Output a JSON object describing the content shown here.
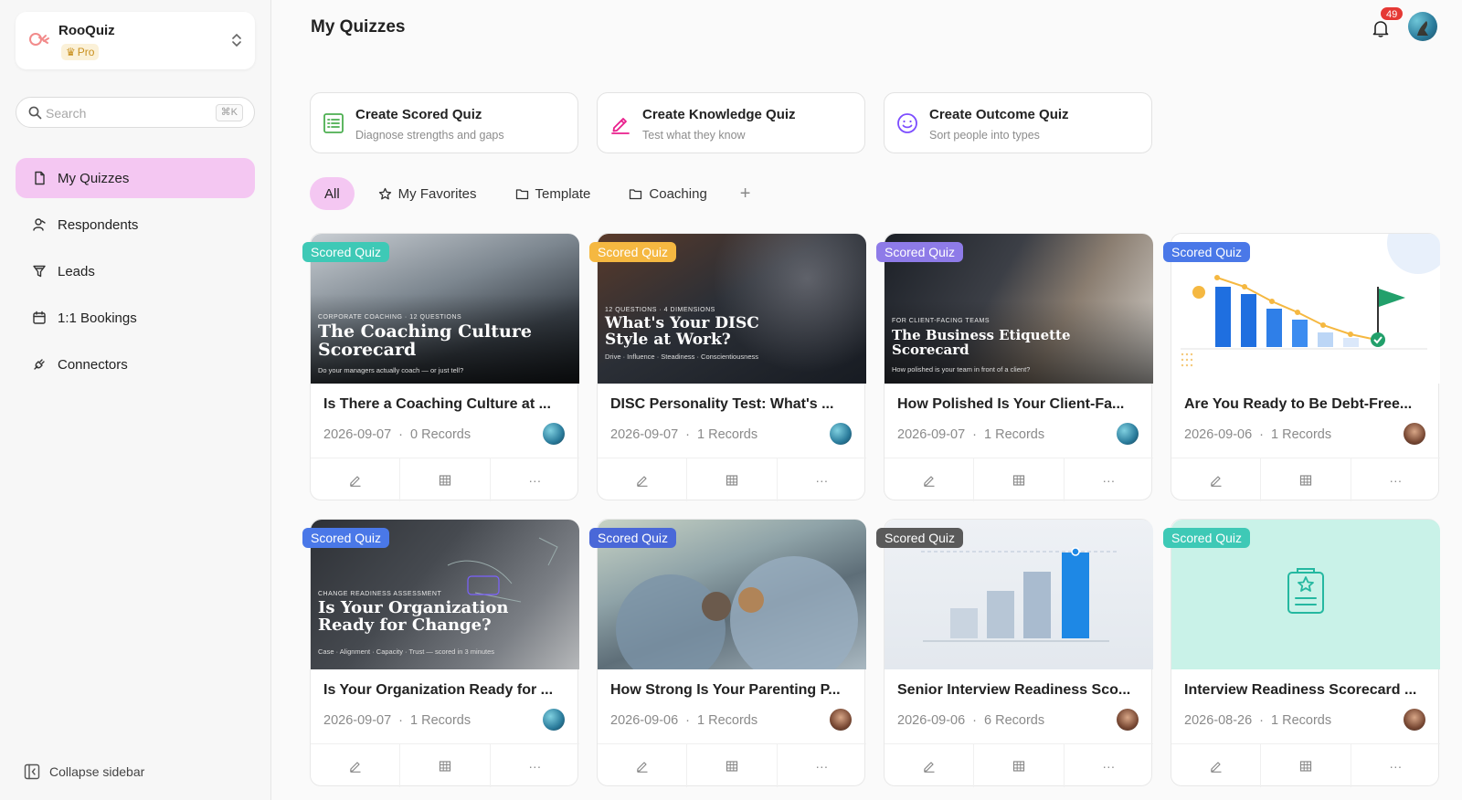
{
  "workspace": {
    "name": "RooQuiz",
    "plan": "Pro"
  },
  "search": {
    "placeholder": "Search",
    "shortcut": "⌘K"
  },
  "nav": [
    {
      "label": "My Quizzes",
      "icon": "document-icon",
      "active": true
    },
    {
      "label": "Respondents",
      "icon": "users-icon"
    },
    {
      "label": "Leads",
      "icon": "funnel-icon"
    },
    {
      "label": "1:1 Bookings",
      "icon": "calendar-icon"
    },
    {
      "label": "Connectors",
      "icon": "plug-icon"
    }
  ],
  "collapse_label": "Collapse sidebar",
  "page_title": "My Quizzes",
  "notifications": {
    "count": "49"
  },
  "create_cards": [
    {
      "title": "Create Scored Quiz",
      "subtitle": "Diagnose strengths and gaps",
      "icon": "checklist-icon",
      "color": "#4caf50"
    },
    {
      "title": "Create Knowledge Quiz",
      "subtitle": "Test what they know",
      "icon": "pen-icon",
      "color": "#e91e8c"
    },
    {
      "title": "Create Outcome Quiz",
      "subtitle": "Sort people into types",
      "icon": "smiley-icon",
      "color": "#7c4dff"
    }
  ],
  "filters": {
    "all": "All",
    "favorites": "My Favorites",
    "template": "Template",
    "coaching": "Coaching",
    "add": "+"
  },
  "quizzes": [
    {
      "tag": "Scored Quiz",
      "tag_color": "#3ec9b6",
      "title": "Is There a Coaching Culture at ...",
      "date": "2026-09-07",
      "records": "0 Records",
      "avatar": "a",
      "thumb": {
        "kicker": "CORPORATE COACHING · 12 QUESTIONS",
        "title": "The Coaching Culture Scorecard",
        "sub": "Do your managers actually coach — or just tell?"
      }
    },
    {
      "tag": "Scored Quiz",
      "tag_color": "#f5b841",
      "title": "DISC Personality Test: What's ...",
      "date": "2026-09-07",
      "records": "1 Records",
      "avatar": "a",
      "thumb": {
        "kicker": "12 QUESTIONS · 4 DIMENSIONS",
        "title": "What's Your DISC Style at Work?",
        "sub": "Drive · Influence · Steadiness · Conscientiousness"
      }
    },
    {
      "tag": "Scored Quiz",
      "tag_color": "#8e7be8",
      "title": "How Polished Is Your Client-Fa...",
      "date": "2026-09-07",
      "records": "1 Records",
      "avatar": "a",
      "thumb": {
        "kicker": "FOR CLIENT-FACING TEAMS",
        "title": "The Business Etiquette Scorecard",
        "sub": "How polished is your team in front of a client?"
      }
    },
    {
      "tag": "Scored Quiz",
      "tag_color": "#4a78e8",
      "title": "Are You Ready to Be Debt-Free...",
      "date": "2026-09-06",
      "records": "1 Records",
      "avatar": "b",
      "thumb": {
        "kicker": "",
        "title": "",
        "sub": ""
      }
    },
    {
      "tag": "Scored Quiz",
      "tag_color": "#4a78e8",
      "title": "Is Your Organization Ready for ...",
      "date": "2026-09-07",
      "records": "1 Records",
      "avatar": "a",
      "thumb": {
        "kicker": "CHANGE READINESS ASSESSMENT",
        "title": "Is Your Organization Ready for Change?",
        "sub": "Case · Alignment · Capacity · Trust — scored in 3 minutes"
      }
    },
    {
      "tag": "Scored Quiz",
      "tag_color": "#4a68d8",
      "title": "How Strong Is Your Parenting P...",
      "date": "2026-09-06",
      "records": "1 Records",
      "avatar": "b",
      "thumb": {
        "kicker": "",
        "title": "",
        "sub": ""
      }
    },
    {
      "tag": "Scored Quiz",
      "tag_color": "#5a5a5a",
      "title": "Senior Interview Readiness Sco...",
      "date": "2026-09-06",
      "records": "6 Records",
      "avatar": "b",
      "thumb": {
        "kicker": "",
        "title": "",
        "sub": ""
      }
    },
    {
      "tag": "Scored Quiz",
      "tag_color": "#3ec9b6",
      "title": "Interview Readiness Scorecard ...",
      "date": "2026-08-26",
      "records": "1 Records",
      "avatar": "b",
      "thumb": {
        "kicker": "",
        "title": "",
        "sub": ""
      }
    }
  ]
}
